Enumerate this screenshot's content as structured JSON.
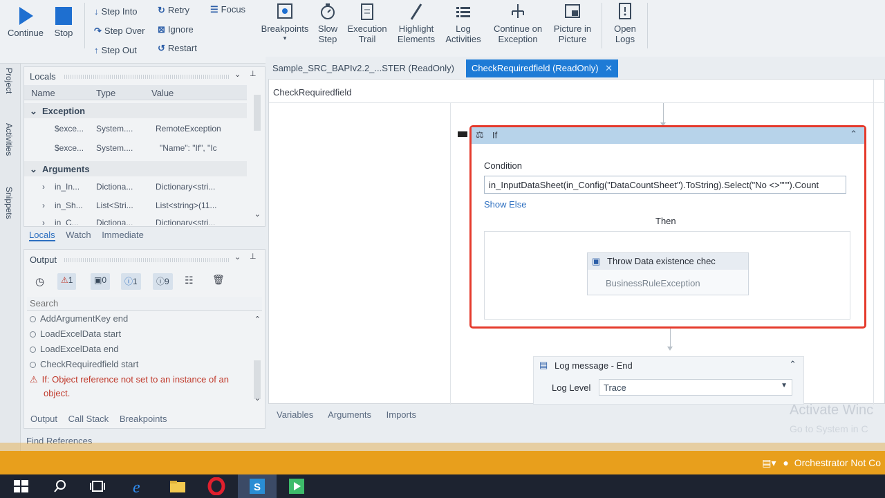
{
  "ribbon": {
    "continue_label": "Continue",
    "stop_label": "Stop",
    "step_into_label": "Step Into",
    "step_over_label": "Step Over",
    "step_out_label": "Step Out",
    "retry_label": "Retry",
    "ignore_label": "Ignore",
    "restart_label": "Restart",
    "focus_label": "Focus",
    "breakpoints_label": "Breakpoints",
    "slow_step_label_1": "Slow",
    "slow_step_label_2": "Step",
    "execution_trail_label_1": "Execution",
    "execution_trail_label_2": "Trail",
    "highlight_elements_label_1": "Highlight",
    "highlight_elements_label_2": "Elements",
    "log_activities_label_1": "Log",
    "log_activities_label_2": "Activities",
    "continue_on_exception_label_1": "Continue on",
    "continue_on_exception_label_2": "Exception",
    "picture_in_picture_label_1": "Picture in",
    "picture_in_picture_label_2": "Picture",
    "open_logs_label_1": "Open",
    "open_logs_label_2": "Logs"
  },
  "rail": {
    "project": "Project",
    "activities": "Activities",
    "snippets": "Snippets"
  },
  "locals": {
    "title": "Locals",
    "columns": [
      "Name",
      "Type",
      "Value"
    ],
    "groups": [
      {
        "label": "Exception",
        "rows": [
          {
            "name": "$exce...",
            "type": "System....",
            "value": "RemoteException"
          },
          {
            "name": "$exce...",
            "type": "System....",
            "value": "\"Name\": \"If\",  \"Ic"
          }
        ]
      },
      {
        "label": "Arguments",
        "rows": [
          {
            "name": "in_In...",
            "type": "Dictiona...",
            "value": "Dictionary<stri..."
          },
          {
            "name": "in_Sh...",
            "type": "List<Stri...",
            "value": "List<string>(11..."
          },
          {
            "name": "in_C...",
            "type": "Dictiona...",
            "value": "Dictionary<stri..."
          }
        ]
      }
    ],
    "tabs": [
      "Locals",
      "Watch",
      "Immediate"
    ]
  },
  "output": {
    "title": "Output",
    "filters": {
      "errors": "1",
      "warnings": "0",
      "info": "1",
      "trace": "9"
    },
    "search_placeholder": "Search",
    "lines": [
      {
        "text": "AddArgumentKey  end",
        "error": false
      },
      {
        "text": "LoadExcelData  start",
        "error": false
      },
      {
        "text": "LoadExcelData  end",
        "error": false
      },
      {
        "text": "CheckRequiredfield  start",
        "error": false
      },
      {
        "text": "If: Object reference not set to an instance of an",
        "error": true
      },
      {
        "text": "object.",
        "error": true
      }
    ],
    "tabs": [
      "Output",
      "Call Stack",
      "Breakpoints"
    ],
    "find_references": "Find References"
  },
  "designer": {
    "tabs": [
      {
        "label": "Sample_SRC_BAPIv2.2_...STER (ReadOnly)",
        "active": false
      },
      {
        "label": "CheckRequiredfield (ReadOnly)",
        "active": true
      }
    ],
    "breadcrumb": "CheckRequiredfield",
    "if_activity": {
      "title": "If",
      "condition_label": "Condition",
      "condition_value": "in_InputDataSheet(in_Config(\"DataCountSheet\").ToString).Select(\"No <>\"\"\").Count",
      "show_else": "Show Else",
      "then_label": "Then",
      "throw_title": "Throw Data existence chec",
      "throw_exception": "BusinessRuleException"
    },
    "log_message": {
      "title": "Log message - End",
      "level_label": "Log Level",
      "level_value": "Trace"
    },
    "bottom_tabs": [
      "Variables",
      "Arguments",
      "Imports"
    ],
    "watermark_1": "Activate Winc",
    "watermark_2": "Go to System in C"
  },
  "status": {
    "orchestrator": "Orchestrator Not Co"
  },
  "colors": {
    "accent": "#1e7bd6",
    "error_border": "#e53a2c",
    "status_bar": "#e89f1c",
    "taskbar": "#1d2330"
  }
}
